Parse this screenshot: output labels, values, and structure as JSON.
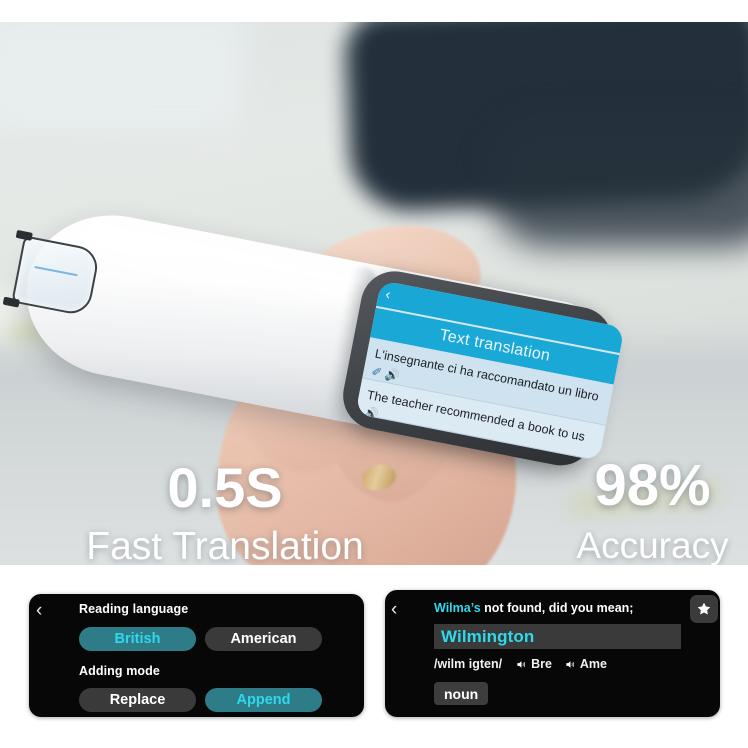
{
  "hero": {
    "device_screen": {
      "back_icon": "‹",
      "title": "Text translation",
      "source_text": "L'insegnante ci ha raccomandato un libro",
      "target_text": "The teacher recommended a book to us",
      "edit_icon": "✐",
      "speaker_icon": "🔊",
      "header_color": "#19a8d6",
      "body_color": "#d2e4f1"
    },
    "stats": [
      {
        "value": "0.5S",
        "caption": "Fast Translation"
      },
      {
        "value": "98%",
        "caption": "Accuracy"
      }
    ]
  },
  "settings_panel": {
    "back_icon": "‹",
    "sections": [
      {
        "label": "Reading language",
        "options": [
          {
            "label": "British",
            "selected": true
          },
          {
            "label": "American",
            "selected": false
          }
        ]
      },
      {
        "label": "Adding mode",
        "options": [
          {
            "label": "Replace",
            "selected": false
          },
          {
            "label": "Append",
            "selected": true
          }
        ]
      }
    ]
  },
  "dictionary_panel": {
    "back_icon": "‹",
    "query": "Wilma’s",
    "suggestion_prompt": "not found, did you mean;",
    "suggested_word": "Wilmington",
    "phonetic": "/wilm igten/",
    "pronunciations": [
      {
        "label": "Bre",
        "icon": "speaker-icon"
      },
      {
        "label": "Ame",
        "icon": "speaker-icon"
      }
    ],
    "part_of_speech": "noun",
    "favorite_icon": "star-icon"
  },
  "colors": {
    "panel_bg": "#070707",
    "accent_cyan": "#2fd8ec",
    "pill_selected_bg": "#2f7c89",
    "pill_unselected_bg": "#3a3a3a",
    "input_bg": "#3a3a3a",
    "screen_header": "#19a8d6"
  }
}
